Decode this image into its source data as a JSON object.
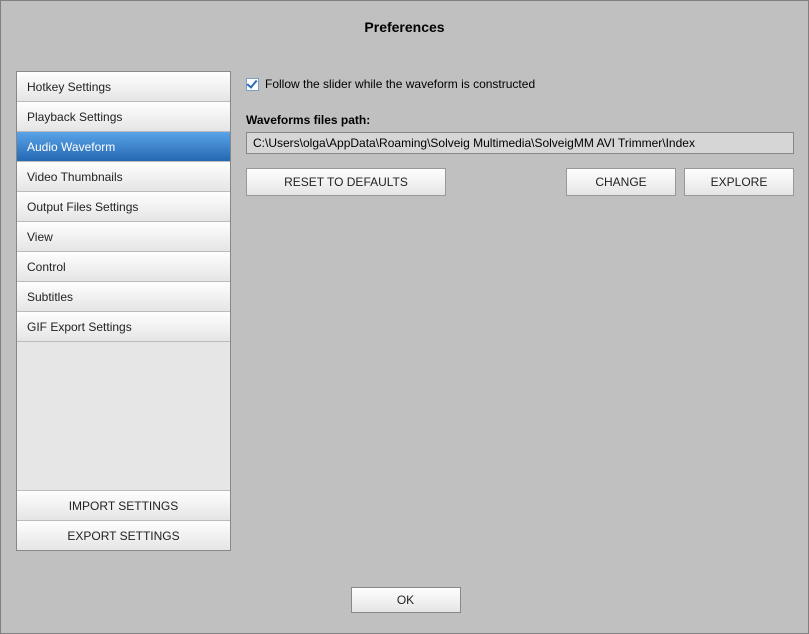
{
  "title": "Preferences",
  "sidebar": {
    "items": [
      {
        "label": "Hotkey Settings",
        "active": false
      },
      {
        "label": "Playback Settings",
        "active": false
      },
      {
        "label": "Audio Waveform",
        "active": true
      },
      {
        "label": "Video Thumbnails",
        "active": false
      },
      {
        "label": "Output Files Settings",
        "active": false
      },
      {
        "label": "View",
        "active": false
      },
      {
        "label": "Control",
        "active": false
      },
      {
        "label": "Subtitles",
        "active": false
      },
      {
        "label": "GIF Export Settings",
        "active": false
      }
    ],
    "import_label": "IMPORT SETTINGS",
    "export_label": "EXPORT SETTINGS"
  },
  "content": {
    "follow_slider_checked": true,
    "follow_slider_label": "Follow the slider while the waveform is constructed",
    "path_label": "Waveforms files path:",
    "path_value": "C:\\Users\\olga\\AppData\\Roaming\\Solveig Multimedia\\SolveigMM AVI Trimmer\\Index",
    "reset_label": "RESET TO DEFAULTS",
    "change_label": "CHANGE",
    "explore_label": "EXPLORE"
  },
  "ok_label": "OK"
}
